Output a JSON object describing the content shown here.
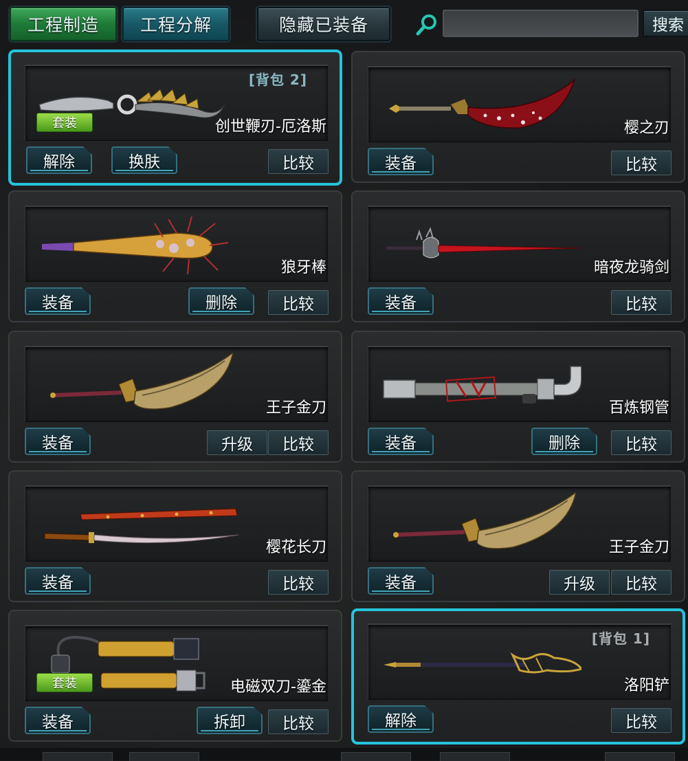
{
  "toolbar": {
    "craft_label": "工程制造",
    "decompose_label": "工程分解",
    "hide_equipped_label": "隐藏已装备",
    "search_placeholder": "",
    "search_label": "搜索"
  },
  "colors": {
    "selected_border": "#26c3dc",
    "set_badge": "#7cc43a",
    "bag_tag": "#8ab8c2"
  },
  "items": [
    {
      "name": "创世鞭刃-厄洛斯",
      "bag_tag": "背包 2",
      "set_badge": "套装",
      "selected": true,
      "icon": "whip-blade-icon",
      "buttons": [
        {
          "label": "解除"
        },
        {
          "label": "换肤"
        }
      ],
      "compare_label": "比较"
    },
    {
      "name": "樱之刃",
      "icon": "crimson-curved-blade-icon",
      "buttons": [
        {
          "label": "装备"
        }
      ],
      "compare_label": "比较"
    },
    {
      "name": "狼牙棒",
      "icon": "spiked-bat-icon",
      "buttons": [
        {
          "label": "装备"
        },
        {
          "label": "删除"
        }
      ],
      "compare_label": "比较"
    },
    {
      "name": "暗夜龙骑剑",
      "icon": "red-long-sword-icon",
      "buttons": [
        {
          "label": "装备"
        }
      ],
      "compare_label": "比较"
    },
    {
      "name": "王子金刀",
      "icon": "golden-dao-icon",
      "buttons": [
        {
          "label": "装备"
        }
      ],
      "upgrade_label": "升级",
      "compare_label": "比较"
    },
    {
      "name": "百炼钢管",
      "icon": "steel-pipe-icon",
      "buttons": [
        {
          "label": "装备"
        },
        {
          "label": "删除"
        }
      ],
      "compare_label": "比较"
    },
    {
      "name": "樱花长刀",
      "icon": "katana-icon",
      "buttons": [
        {
          "label": "装备"
        }
      ],
      "compare_label": "比较"
    },
    {
      "name": "王子金刀",
      "icon": "golden-dao-icon",
      "buttons": [
        {
          "label": "装备"
        }
      ],
      "upgrade_label": "升级",
      "compare_label": "比较"
    },
    {
      "name": "电磁双刀-鎏金",
      "set_badge": "套装",
      "icon": "electromagnetic-dual-blade-icon",
      "buttons": [
        {
          "label": "装备"
        },
        {
          "label": "拆卸"
        }
      ],
      "compare_label": "比较"
    },
    {
      "name": "洛阳铲",
      "bag_tag": "背包 1",
      "selected": true,
      "icon": "luoyang-shovel-icon",
      "buttons": [
        {
          "label": "解除"
        }
      ],
      "compare_label": "比较"
    }
  ]
}
